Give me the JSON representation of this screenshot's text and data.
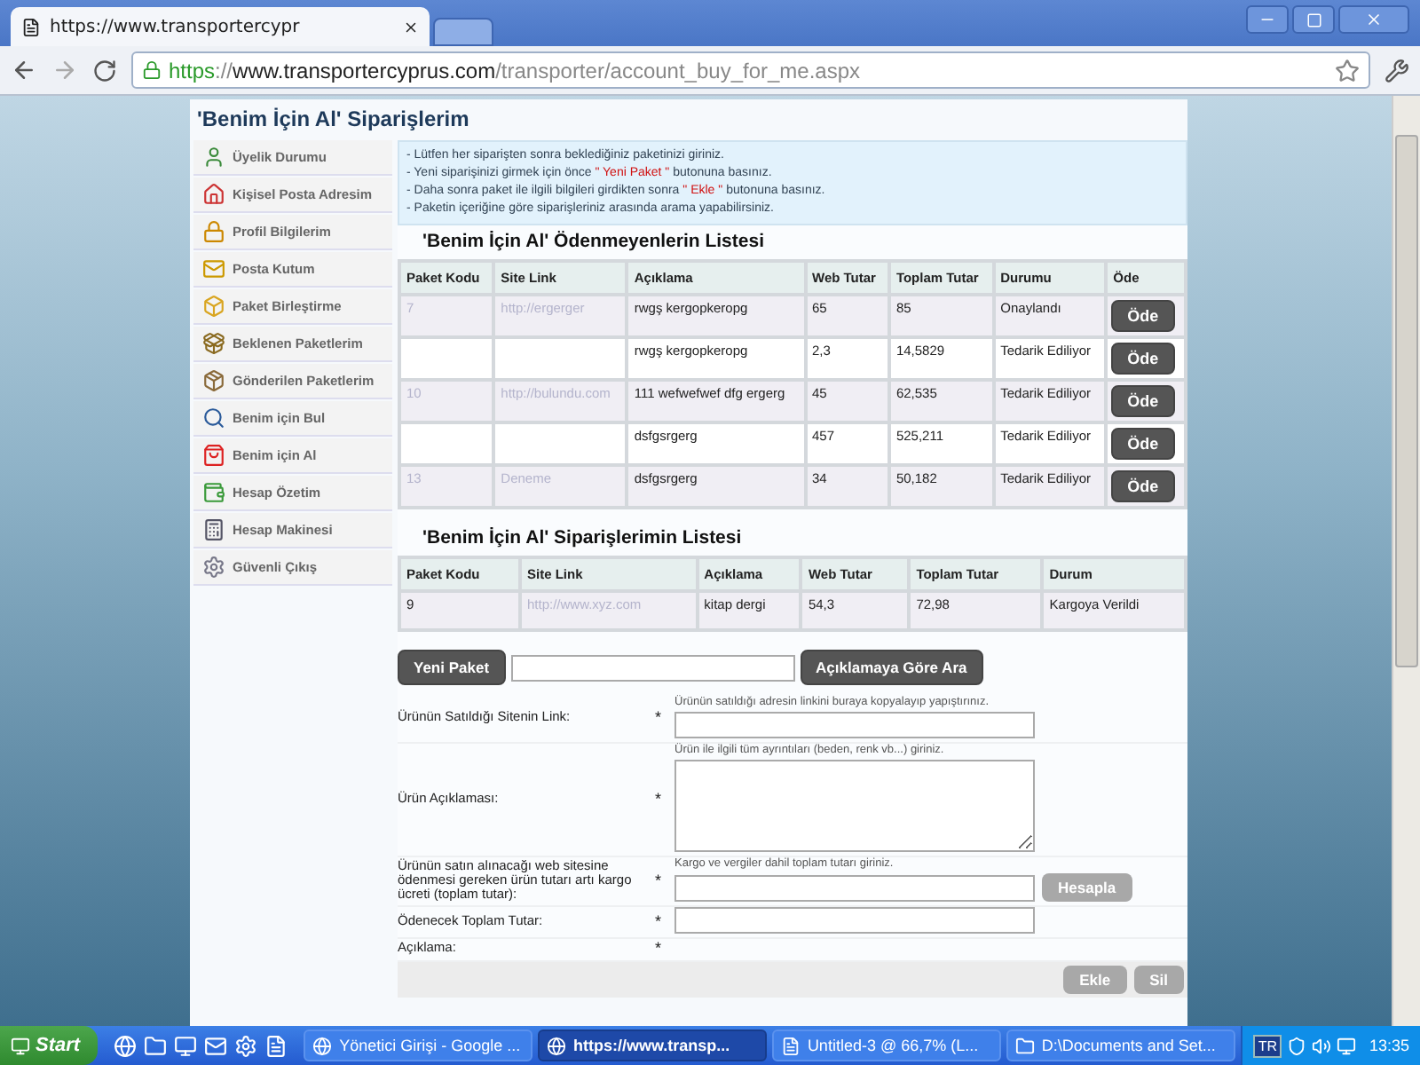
{
  "browser": {
    "tab_title": "https://www.transportercypr",
    "url_parts": [
      {
        "kind": "scheme",
        "text": "https"
      },
      {
        "kind": "sep",
        "text": "://"
      },
      {
        "kind": "host",
        "text": "www.transportercyprus.com"
      },
      {
        "kind": "path",
        "text": "/transporter/account_buy_for_me.aspx"
      }
    ]
  },
  "page_title": "'Benim İçin Al' Siparişlerim",
  "sidebar": [
    "Üyelik Durumu",
    "Kişisel Posta Adresim",
    "Profil Bilgilerim",
    "Posta Kutum",
    "Paket Birleştirme",
    "Beklenen Paketlerim",
    "Gönderilen Paketlerim",
    "Benim için Bul",
    "Benim için Al",
    "Hesap Özetim",
    "Hesap Makinesi",
    "Güvenli Çıkış"
  ],
  "notes": [
    [
      {
        "text": "- Lütfen her siparişten sonra beklediğiniz paketinizi giriniz.",
        "highlight": false
      }
    ],
    [
      {
        "text": "- Yeni siparişinizi girmek için önce ",
        "highlight": false
      },
      {
        "text": "\" Yeni Paket \"",
        "highlight": true
      },
      {
        "text": " butonuna basınız.",
        "highlight": false
      }
    ],
    [
      {
        "text": "- Daha sonra paket ile ilgili bilgileri girdikten sonra ",
        "highlight": false
      },
      {
        "text": "\" Ekle \"",
        "highlight": true
      },
      {
        "text": " butonuna basınız.",
        "highlight": false
      }
    ],
    [
      {
        "text": "- Paketin içeriğine göre siparişleriniz arasında arama yapabilirsiniz.",
        "highlight": false
      }
    ]
  ],
  "unpaid_table": {
    "title": "'Benim İçin Al' Ödenmeyenlerin Listesi",
    "columns": [
      "Paket Kodu",
      "Site Link",
      "Açıklama",
      "Web Tutar",
      "Toplam Tutar",
      "Durumu",
      "Öde"
    ],
    "rows": [
      {
        "code": "7",
        "link": "http://ergerger",
        "desc": "rwgş kergopkeropg",
        "web": "65",
        "total": "85",
        "status": "Onaylandı",
        "button": "Öde"
      },
      {
        "code": "",
        "link": "",
        "desc": "rwgş kergopkeropg",
        "web": "2,3",
        "total": "14,5829",
        "status": "Tedarik Ediliyor",
        "button": "Öde"
      },
      {
        "code": "10",
        "link": "http://bulundu.com",
        "desc": "111 wefwefwef dfg ergerg",
        "web": "45",
        "total": "62,535",
        "status": "Tedarik Ediliyor",
        "button": "Öde"
      },
      {
        "code": "",
        "link": "",
        "desc": "dsfgsrgerg",
        "web": "457",
        "total": "525,211",
        "status": "Tedarik Ediliyor",
        "button": "Öde"
      },
      {
        "code": "13",
        "link": "Deneme",
        "desc": "dsfgsrgerg",
        "web": "34",
        "total": "50,182",
        "status": "Tedarik Ediliyor",
        "button": "Öde"
      }
    ]
  },
  "orders_table": {
    "title": "'Benim İçin Al' Siparişlerimin Listesi",
    "columns": [
      "Paket Kodu",
      "Site Link",
      "Açıklama",
      "Web Tutar",
      "Toplam Tutar",
      "Durum"
    ],
    "rows": [
      {
        "code": "9",
        "link": "http://www.xyz.com",
        "desc": "kitap dergi",
        "web": "54,3",
        "total": "72,98",
        "status": "Kargoya Verildi"
      }
    ]
  },
  "search": {
    "new_button": "Yeni Paket",
    "search_button": "Açıklamaya Göre Ara"
  },
  "form": [
    {
      "kind": "input",
      "label": "Ürünün Satıldığı Sitenin Link:",
      "required": "*",
      "hint": "Ürünün satıldığı adresin linkini buraya kopyalayıp yapıştırınız."
    },
    {
      "kind": "textarea",
      "label": "Ürün Açıklaması:",
      "required": "*",
      "hint": "Ürün ile ilgili tüm ayrıntıları (beden, renk vb...) giriniz."
    },
    {
      "kind": "input_button",
      "label": "Ürünün satın alınacağı web sitesine ödenmesi gereken ürün tutarı artı kargo ücreti (toplam tutar):",
      "required": "*",
      "hint": "Kargo ve vergiler dahil toplam tutarı giriniz.",
      "button": "Hesapla"
    },
    {
      "kind": "input",
      "label": "Ödenecek Toplam Tutar:",
      "required": "*"
    },
    {
      "kind": "none",
      "label": "Açıklama:",
      "required": "*"
    }
  ],
  "form_buttons": [
    "Ekle",
    "Sil"
  ],
  "taskbar": {
    "start": "Start",
    "tasks": [
      {
        "label": "Yönetici Girişi - Google ...",
        "selected": false
      },
      {
        "label": "https://www.transp...",
        "selected": true
      },
      {
        "label": "Untitled-3 @ 66,7% (L...",
        "selected": false
      },
      {
        "label": "D:\\Documents and Set...",
        "selected": false
      }
    ],
    "language": "TR",
    "time": "13:35"
  }
}
